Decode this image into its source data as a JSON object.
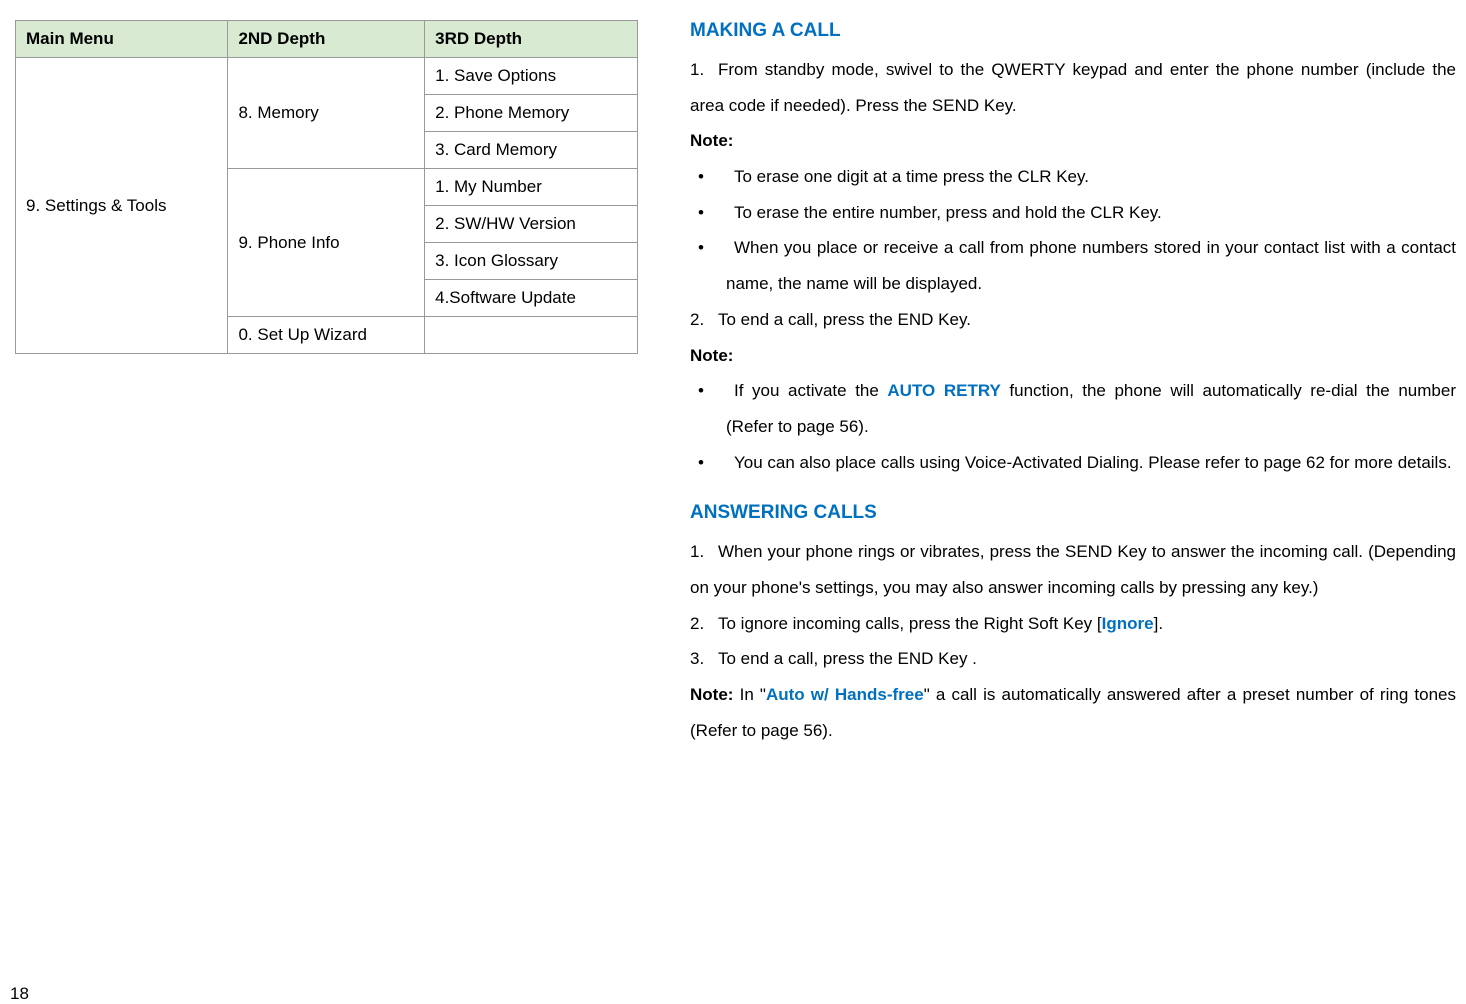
{
  "table": {
    "headers": [
      "Main Menu",
      "2ND Depth",
      "3RD Depth"
    ],
    "mainMenu": "9. Settings & Tools",
    "groups": [
      {
        "depth2": "8. Memory",
        "depth3": [
          "1. Save Options",
          "2. Phone Memory",
          "3. Card Memory"
        ]
      },
      {
        "depth2": "9. Phone Info",
        "depth3": [
          "1. My Number",
          "2. SW/HW Version",
          "3. Icon Glossary",
          "4.Software Update"
        ]
      },
      {
        "depth2": "0. Set Up Wizard",
        "depth3": [
          ""
        ]
      }
    ]
  },
  "pageNumber": "18",
  "section1": {
    "heading": "MAKING A CALL",
    "step1_num": "1.",
    "step1_text": "From standby mode, swivel to the QWERTY keypad and enter the phone number (include the area code if needed). Press the SEND Key.",
    "note1Label": "Note:",
    "bullets1": [
      "To erase one digit at a time press the CLR Key.",
      "To erase the entire number, press and hold the CLR Key.",
      "When you place or receive a call from phone numbers stored in your contact list with a contact name, the name will be displayed."
    ],
    "step2_num": "2.",
    "step2_text": "To end a call, press the END Key.",
    "note2Label": "Note:",
    "bullet2a_pre": "If you activate the ",
    "bullet2a_hl": "AUTO RETRY",
    "bullet2a_post": " function, the phone will automatically re-dial the number (Refer to page 56).",
    "bullet2b": "You can also place calls using Voice-Activated Dialing. Please refer to page 62 for more details."
  },
  "section2": {
    "heading": "ANSWERING CALLS",
    "step1_num": "1.",
    "step1_text": "When your phone rings or vibrates, press the SEND Key to answer the incoming call. (Depending on your phone's settings, you may also answer incoming calls by pressing any key.)",
    "step2_num": "2.",
    "step2_pre": "To ignore incoming calls, press the Right Soft Key [",
    "step2_hl": "Ignore",
    "step2_post": "].",
    "step3_num": "3.",
    "step3_text": "To end a call, press the END Key .",
    "noteLabel": "Note:",
    "note_pre": " In \"",
    "note_hl": "Auto w/ Hands-free",
    "note_post": "\" a call is automatically answered after a preset number of ring tones (Refer to page 56)."
  }
}
